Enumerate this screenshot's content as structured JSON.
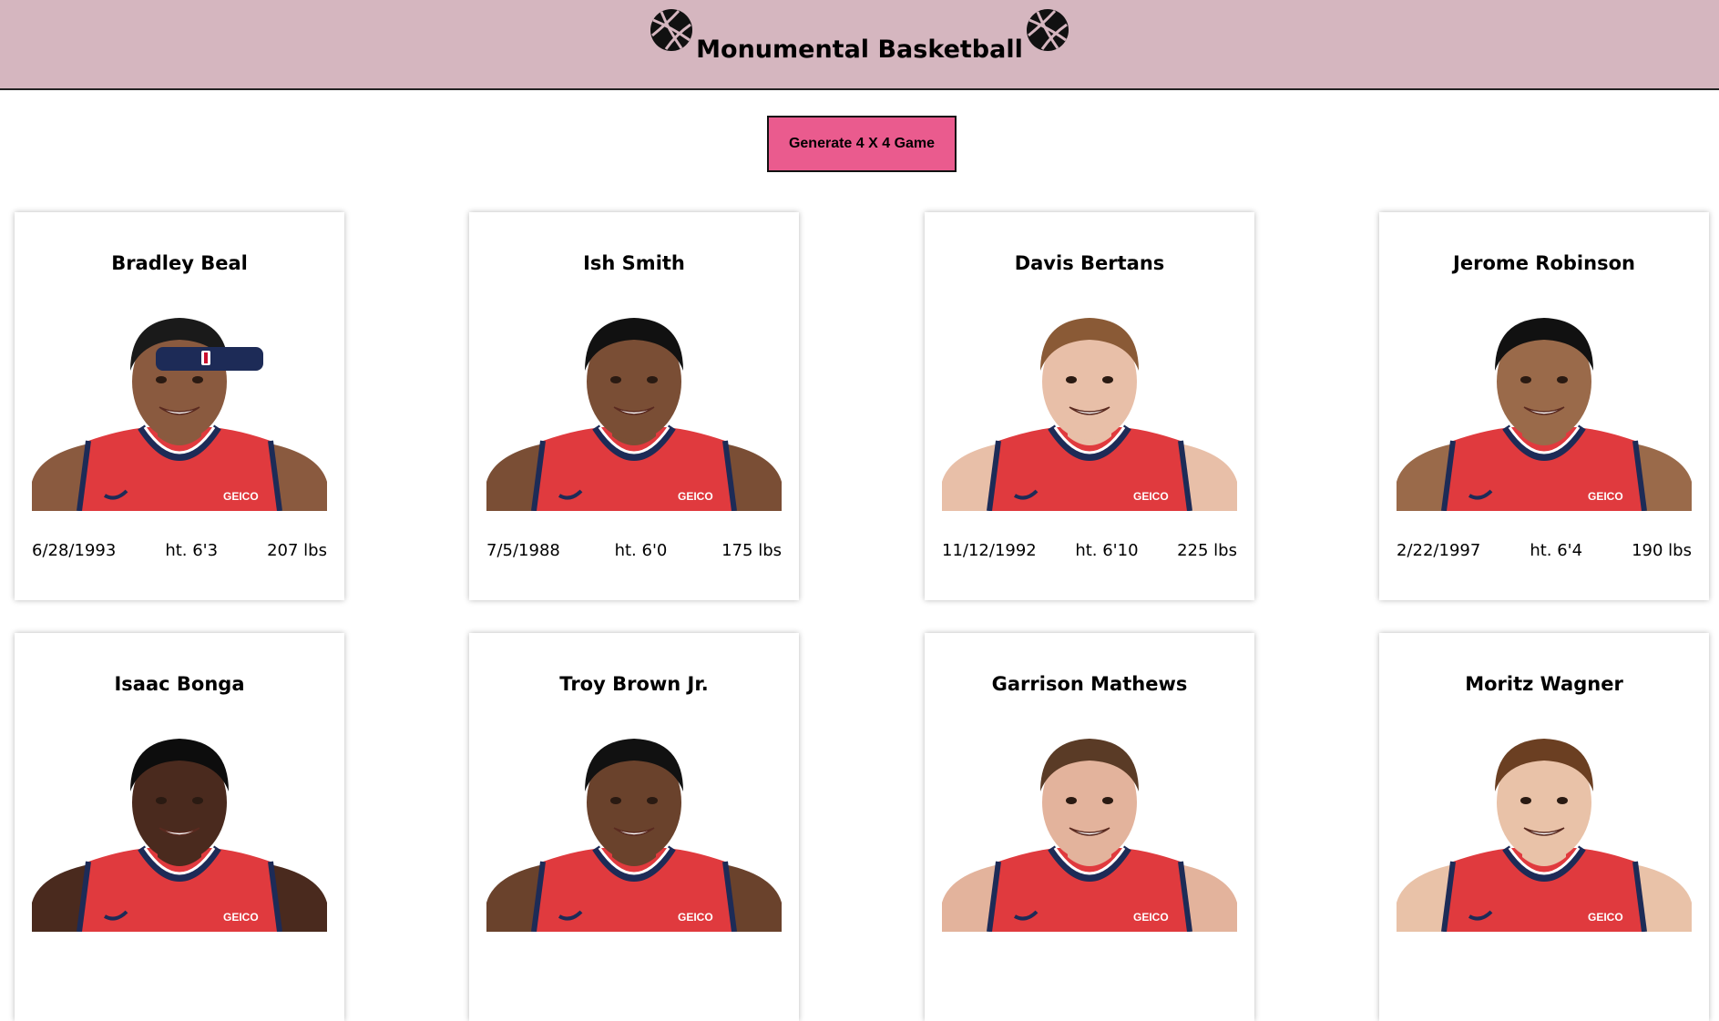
{
  "header": {
    "title": "Monumental Basketball",
    "left_icon": "basketball-icon",
    "right_icon": "basketball-icon",
    "background_color": "#d5b6bf"
  },
  "generate_button": {
    "label": "Generate 4 X 4 Game",
    "color": "#ea5b8e"
  },
  "players": [
    {
      "name": "Bradley Beal",
      "dob": "6/28/1993",
      "height": "ht. 6'3",
      "weight": "207 lbs",
      "skin": "#8a5a3f",
      "hair": "#1a1a1a",
      "headband": true
    },
    {
      "name": "Ish Smith",
      "dob": "7/5/1988",
      "height": "ht. 6'0",
      "weight": "175 lbs",
      "skin": "#7a4e35",
      "hair": "#111111",
      "headband": false
    },
    {
      "name": "Davis Bertans",
      "dob": "11/12/1992",
      "height": "ht. 6'10",
      "weight": "225 lbs",
      "skin": "#e8bfa8",
      "hair": "#8a5a36",
      "headband": false
    },
    {
      "name": "Jerome Robinson",
      "dob": "2/22/1997",
      "height": "ht. 6'4",
      "weight": "190 lbs",
      "skin": "#9a6a4a",
      "hair": "#111111",
      "headband": false
    },
    {
      "name": "Isaac Bonga",
      "dob": "",
      "height": "",
      "weight": "",
      "skin": "#4a2a1e",
      "hair": "#0d0d0d",
      "headband": false
    },
    {
      "name": "Troy Brown Jr.",
      "dob": "",
      "height": "",
      "weight": "",
      "skin": "#6a422c",
      "hair": "#111111",
      "headband": false
    },
    {
      "name": "Garrison Mathews",
      "dob": "",
      "height": "",
      "weight": "",
      "skin": "#e3b39c",
      "hair": "#5a3b26",
      "headband": false
    },
    {
      "name": "Moritz Wagner",
      "dob": "",
      "height": "",
      "weight": "",
      "skin": "#e9c2a8",
      "hair": "#6b3f22",
      "headband": false
    }
  ],
  "jersey_color": "#e03a3e",
  "jersey_trim": "#1d2b57",
  "jersey_logo": "GEICO"
}
